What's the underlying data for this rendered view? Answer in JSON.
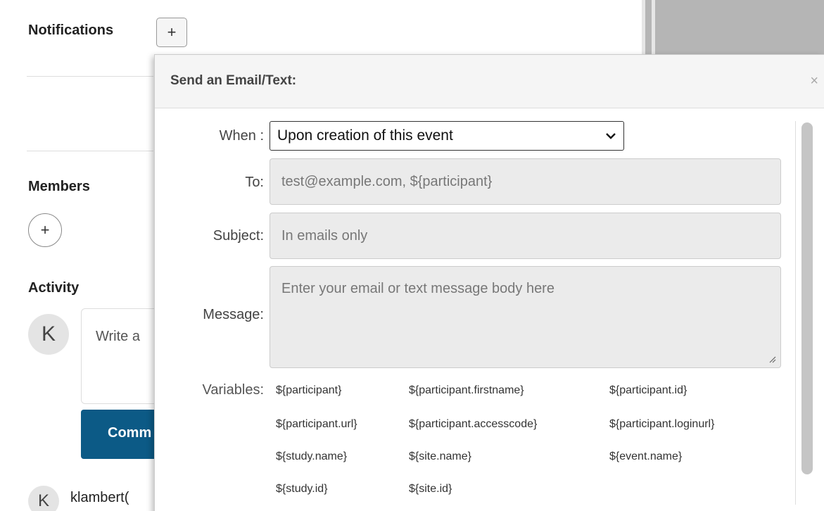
{
  "background": {
    "notifications_title": "Notifications",
    "add_notification_symbol": "+",
    "members_title": "Members",
    "add_member_symbol": "+",
    "activity_title": "Activity",
    "avatar_initial": "K",
    "write_placeholder": "Write a",
    "comment_button": "Comm",
    "activity_user_initial": "K",
    "activity_user": "klambert("
  },
  "modal": {
    "title": "Send an Email/Text:",
    "close_symbol": "×",
    "when_label": "When :",
    "when_value": "Upon creation of this event",
    "to_label": "To:",
    "to_placeholder": "test@example.com, ${participant}",
    "subject_label": "Subject:",
    "subject_placeholder": "In emails only",
    "message_label": "Message:",
    "message_placeholder": "Enter your email or text message body here",
    "variables_label": "Variables:",
    "variables": [
      "${participant}",
      "${participant.firstname}",
      "${participant.id}",
      "${participant.url}",
      "${participant.accesscode}",
      "${participant.loginurl}",
      "${study.name}",
      "${site.name}",
      "${event.name}",
      "${study.id}",
      "${site.id}"
    ]
  },
  "icons": {
    "dropdown": "chevron-down-icon",
    "close": "close-icon",
    "resize": "resize-grip-icon"
  },
  "colors": {
    "primary_button": "#0c5a86",
    "field_bg": "#ebebeb",
    "modal_header_bg": "#f5f5f5"
  }
}
